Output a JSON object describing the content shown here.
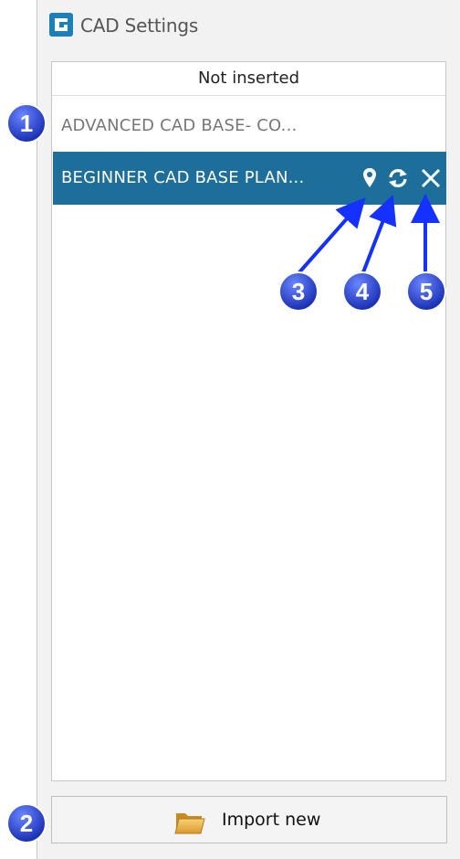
{
  "window": {
    "title": "CAD Settings"
  },
  "list": {
    "header": "Not inserted",
    "items": [
      {
        "label": "ADVANCED CAD BASE- CO...",
        "selected": false
      },
      {
        "label": "BEGINNER CAD BASE PLAN...",
        "selected": true
      }
    ],
    "actions": [
      "map-pin-icon",
      "refresh-icon",
      "close-icon"
    ]
  },
  "import": {
    "label": "Import new",
    "icon": "folder-icon"
  },
  "callouts": {
    "one": "1",
    "two": "2",
    "three": "3",
    "four": "4",
    "five": "5"
  },
  "colors": {
    "selected_row": "#1d6e9b",
    "callout_blue": "#1a35c9",
    "arrow_blue": "#1431ff"
  }
}
